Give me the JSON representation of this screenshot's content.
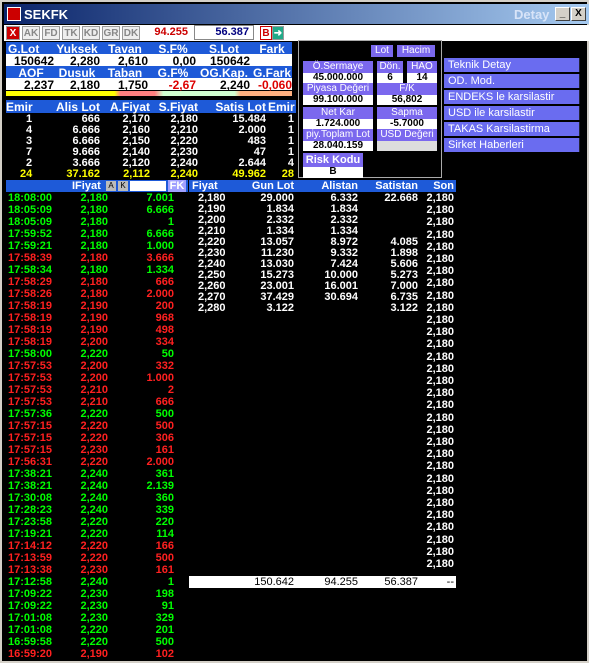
{
  "window": {
    "title": "SEKFK",
    "title_right": "Detay",
    "minimize": "_",
    "maximize": "□",
    "close": "X"
  },
  "toolbar": {
    "buttons": [
      "X",
      "AK",
      "FD",
      "TK",
      "KD",
      "GR",
      "DK"
    ],
    "price1": "94.255",
    "price2": "56.387",
    "b_label": "B"
  },
  "summary": {
    "headers1": [
      "G.Lot",
      "Yuksek",
      "Tavan",
      "S.F%",
      "S.Lot",
      "Fark"
    ],
    "values1": [
      "150642",
      "2,280",
      "2,610",
      "0,00",
      "150642",
      ""
    ],
    "headers2": [
      "AOF",
      "Dusuk",
      "Taban",
      "G.F%",
      "OG.Kap.",
      "G.Fark"
    ],
    "values2": [
      "2,237",
      "2,180",
      "1,750",
      "-2,67",
      "2,240",
      "-0,060"
    ]
  },
  "depth": {
    "headers": [
      "Emir",
      "Alis Lot",
      "A.Fiyat",
      "S.Fiyat",
      "Satis Lot",
      "Emir"
    ],
    "rows": [
      [
        "1",
        "666",
        "2,170",
        "2,180",
        "15.484",
        "1"
      ],
      [
        "4",
        "6.666",
        "2,160",
        "2,210",
        "2.000",
        "1"
      ],
      [
        "3",
        "6.666",
        "2,150",
        "2,220",
        "483",
        "1"
      ],
      [
        "7",
        "9.666",
        "2,140",
        "2,230",
        "47",
        "1"
      ],
      [
        "2",
        "3.666",
        "2,120",
        "2,240",
        "2.644",
        "4"
      ]
    ],
    "totals": [
      "24",
      "37.162",
      "2,112",
      "2,240",
      "49.962",
      "28"
    ]
  },
  "info_panel": {
    "lot_btn": "Lot",
    "hacim_btn": "Hacim",
    "osermaye_label": "Ö.Sermaye",
    "osermaye_val": "45.000.000",
    "don_label": "Dön.",
    "don_val": "6",
    "hao_label": "HAO",
    "hao_val": "14",
    "piyasa_label": "Piyasa Değeri",
    "piyasa_val": "99.100.000",
    "fk_label": "F/K",
    "fk_val": "56,802",
    "netkar_label": "Net Kar",
    "netkar_val": "1.724.000",
    "sapma_label": "Sapma",
    "sapma_val": "-5.7000",
    "piytoplam_label": "piy.Toplam Lot",
    "piytoplam_val": "28.040.159",
    "usd_label": "USD Değeri",
    "usd_val": "",
    "risk_label": "Risk Kodu",
    "risk_val": "B"
  },
  "menu": [
    "Teknik Detay",
    "OD. Mod.",
    "ENDEKS le karsilastir",
    "USD ile karsilastir",
    "TAKAS Karsilastirma",
    "Sirket Haberleri"
  ],
  "trades": {
    "headers": [
      "",
      "IFiyat",
      "",
      "FK"
    ],
    "a_label": "A",
    "k_label": "K",
    "rows": [
      [
        "18:08:00",
        "2,180",
        "7.001",
        "g"
      ],
      [
        "18:05:09",
        "2,180",
        "6.666",
        "g"
      ],
      [
        "18:05:09",
        "2,180",
        "1",
        "g"
      ],
      [
        "17:59:52",
        "2,180",
        "6.666",
        "g"
      ],
      [
        "17:59:21",
        "2,180",
        "1.000",
        "g"
      ],
      [
        "17:58:39",
        "2,180",
        "3.666",
        "r"
      ],
      [
        "17:58:34",
        "2,180",
        "1.334",
        "g"
      ],
      [
        "17:58:29",
        "2,180",
        "666",
        "r"
      ],
      [
        "17:58:26",
        "2,180",
        "2.000",
        "r"
      ],
      [
        "17:58:19",
        "2,190",
        "200",
        "r"
      ],
      [
        "17:58:19",
        "2,190",
        "968",
        "r"
      ],
      [
        "17:58:19",
        "2,190",
        "498",
        "r"
      ],
      [
        "17:58:19",
        "2,200",
        "334",
        "r"
      ],
      [
        "17:58:00",
        "2,220",
        "50",
        "g"
      ],
      [
        "17:57:53",
        "2,200",
        "332",
        "r"
      ],
      [
        "17:57:53",
        "2,200",
        "1.000",
        "r"
      ],
      [
        "17:57:53",
        "2,210",
        "2",
        "r"
      ],
      [
        "17:57:53",
        "2,210",
        "666",
        "r"
      ],
      [
        "17:57:36",
        "2,220",
        "500",
        "g"
      ],
      [
        "17:57:15",
        "2,220",
        "500",
        "r"
      ],
      [
        "17:57:15",
        "2,220",
        "306",
        "r"
      ],
      [
        "17:57:15",
        "2,230",
        "161",
        "r"
      ],
      [
        "17:56:31",
        "2,220",
        "2.000",
        "r"
      ],
      [
        "17:38:21",
        "2,240",
        "361",
        "g"
      ],
      [
        "17:38:21",
        "2,240",
        "2.139",
        "g"
      ],
      [
        "17:30:08",
        "2,240",
        "360",
        "g"
      ],
      [
        "17:28:23",
        "2,240",
        "339",
        "g"
      ],
      [
        "17:23:58",
        "2,220",
        "220",
        "g"
      ],
      [
        "17:19:21",
        "2,220",
        "114",
        "g"
      ],
      [
        "17:14:12",
        "2,220",
        "166",
        "r"
      ],
      [
        "17:13:59",
        "2,220",
        "500",
        "r"
      ],
      [
        "17:13:38",
        "2,230",
        "161",
        "r"
      ],
      [
        "17:12:58",
        "2,240",
        "1",
        "g"
      ],
      [
        "17:09:22",
        "2,230",
        "198",
        "g"
      ],
      [
        "17:09:22",
        "2,230",
        "91",
        "g"
      ],
      [
        "17:01:08",
        "2,230",
        "329",
        "g"
      ],
      [
        "17:01:08",
        "2,220",
        "201",
        "g"
      ],
      [
        "16:59:58",
        "2,220",
        "500",
        "g"
      ],
      [
        "16:59:20",
        "2,190",
        "102",
        "r"
      ]
    ]
  },
  "distribution": {
    "headers": [
      "Fiyat",
      "Gun Lot",
      "Alistan",
      "Satistan",
      "Son"
    ],
    "rows": [
      [
        "2,180",
        "29.000",
        "6.332",
        "22.668"
      ],
      [
        "2,190",
        "1.834",
        "1.834",
        ""
      ],
      [
        "2,200",
        "2.332",
        "2.332",
        ""
      ],
      [
        "2,210",
        "1.334",
        "1.334",
        ""
      ],
      [
        "2,220",
        "13.057",
        "8.972",
        "4.085"
      ],
      [
        "2,230",
        "11.230",
        "9.332",
        "1.898"
      ],
      [
        "2,240",
        "13.030",
        "7.424",
        "5.606"
      ],
      [
        "2,250",
        "15.273",
        "10.000",
        "5.273"
      ],
      [
        "2,260",
        "23.001",
        "16.001",
        "7.000"
      ],
      [
        "2,270",
        "37.429",
        "30.694",
        "6.735"
      ],
      [
        "2,280",
        "3.122",
        "",
        "3.122"
      ]
    ],
    "son_values": [
      "2,180",
      "2,180",
      "2,180",
      "2,180",
      "2,180",
      "2,180",
      "2,180",
      "2,180",
      "2,180",
      "2,180",
      "2,180",
      "2,180",
      "2,180",
      "2,180",
      "2,180",
      "2,180",
      "2,180",
      "2,180",
      "2,180",
      "2,180",
      "2,180",
      "2,180",
      "2,180",
      "2,180",
      "2,180",
      "2,180",
      "2,180",
      "2,180",
      "2,180",
      "2,180",
      "2,180"
    ],
    "totals": [
      "",
      "150.642",
      "94.255",
      "56.387",
      "--"
    ]
  }
}
